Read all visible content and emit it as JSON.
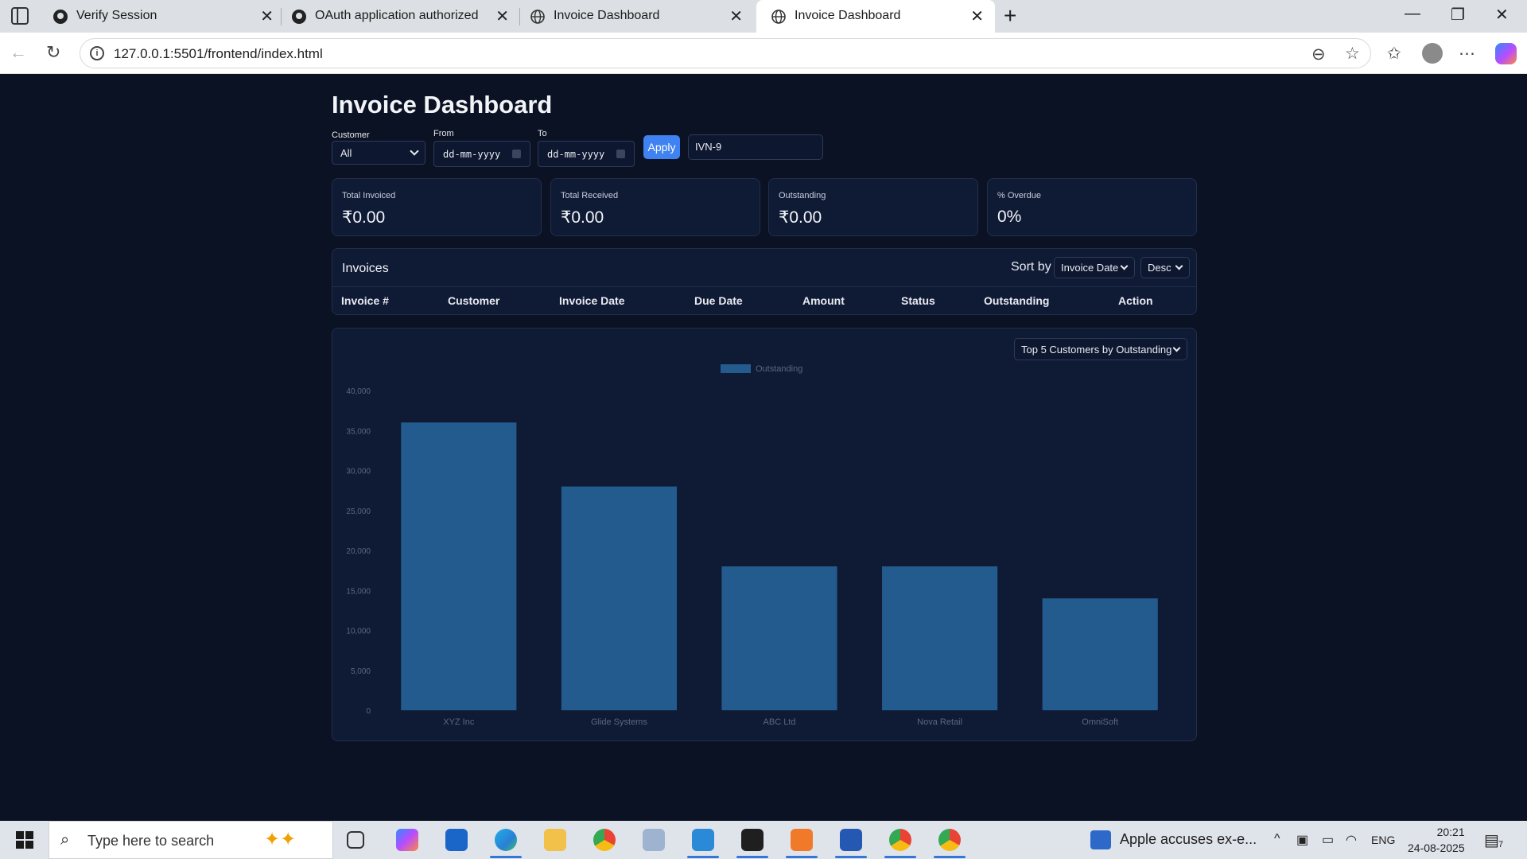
{
  "browser": {
    "tabs": [
      {
        "title": "Verify Session",
        "icon": "github-icon"
      },
      {
        "title": "OAuth application authorized",
        "icon": "github-icon"
      },
      {
        "title": "Invoice Dashboard",
        "icon": "globe-icon"
      },
      {
        "title": "Invoice Dashboard",
        "icon": "globe-icon",
        "active": true
      }
    ],
    "url": "127.0.0.1:5501/frontend/index.html"
  },
  "dashboard": {
    "title": "Invoice Dashboard",
    "filters": {
      "customer_label": "Customer",
      "customer_value": "All",
      "from_label": "From",
      "from_value": "dd-mm-yyyy",
      "to_label": "To",
      "to_value": "dd-mm-yyyy",
      "apply_label": "Apply",
      "search_value": "IVN-9"
    },
    "kpis": [
      {
        "label": "Total Invoiced",
        "value": "₹0.00"
      },
      {
        "label": "Total Received",
        "value": "₹0.00"
      },
      {
        "label": "Outstanding",
        "value": "₹0.00"
      },
      {
        "label": "% Overdue",
        "value": "0%"
      }
    ],
    "invoices": {
      "title": "Invoices",
      "sort_label": "Sort by",
      "sort_field": "Invoice Date",
      "sort_order": "Desc",
      "columns": [
        "Invoice #",
        "Customer",
        "Invoice Date",
        "Due Date",
        "Amount",
        "Status",
        "Outstanding",
        "Action"
      ]
    },
    "chart_selector": "Top 5 Customers by Outstanding"
  },
  "chart_data": {
    "type": "bar",
    "categories": [
      "XYZ Inc",
      "Glide Systems",
      "ABC Ltd",
      "Nova Retail",
      "OmniSoft"
    ],
    "series": [
      {
        "name": "Outstanding",
        "values": [
          36000,
          28000,
          18000,
          18000,
          14000
        ]
      }
    ],
    "ylim": [
      0,
      40000
    ],
    "yticks": [
      "0",
      "5,000",
      "10,000",
      "15,000",
      "20,000",
      "25,000",
      "30,000",
      "35,000",
      "40,000"
    ],
    "legend": "top-center",
    "bar_color": "#245b8f",
    "grid": false
  },
  "taskbar": {
    "search_placeholder": "Type here to search",
    "news": "Apple accuses ex-e...",
    "language": "ENG",
    "time": "20:21",
    "date": "24-08-2025",
    "notification_count": "7"
  }
}
